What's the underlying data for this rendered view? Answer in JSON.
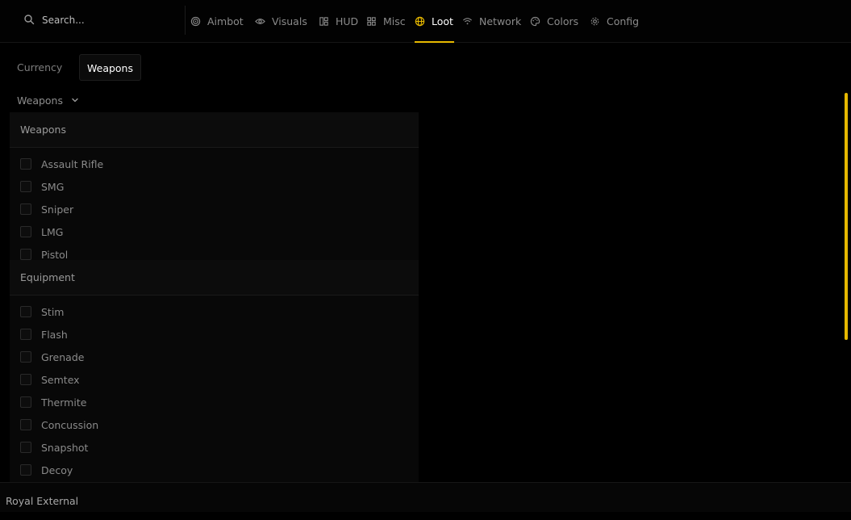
{
  "search": {
    "placeholder": "Search...",
    "value": "",
    "icon": "search-icon"
  },
  "nav": {
    "accent": "#e6b800",
    "items": [
      {
        "label": "Aimbot",
        "icon": "target-icon"
      },
      {
        "label": "Visuals",
        "icon": "eye-icon"
      },
      {
        "label": "HUD",
        "icon": "hud-icon"
      },
      {
        "label": "Misc",
        "icon": "grid-icon"
      },
      {
        "label": "Loot",
        "icon": "globe-icon",
        "active": true
      },
      {
        "label": "Network",
        "icon": "wifi-icon"
      },
      {
        "label": "Colors",
        "icon": "palette-icon"
      },
      {
        "label": "Config",
        "icon": "gear-icon"
      }
    ]
  },
  "subtabs": [
    {
      "label": "Currency"
    },
    {
      "label": "Weapons",
      "active": true
    }
  ],
  "dropdown": {
    "label": "Weapons",
    "icon": "chevron-down-icon"
  },
  "sections": [
    {
      "title": "Weapons",
      "items": [
        "Assault Rifle",
        "SMG",
        "Sniper",
        "LMG",
        "Pistol"
      ]
    },
    {
      "title": "Equipment",
      "items": [
        "Stim",
        "Flash",
        "Grenade",
        "Semtex",
        "Thermite",
        "Concussion",
        "Snapshot",
        "Decoy"
      ]
    }
  ],
  "footer": {
    "title": "Royal External"
  }
}
